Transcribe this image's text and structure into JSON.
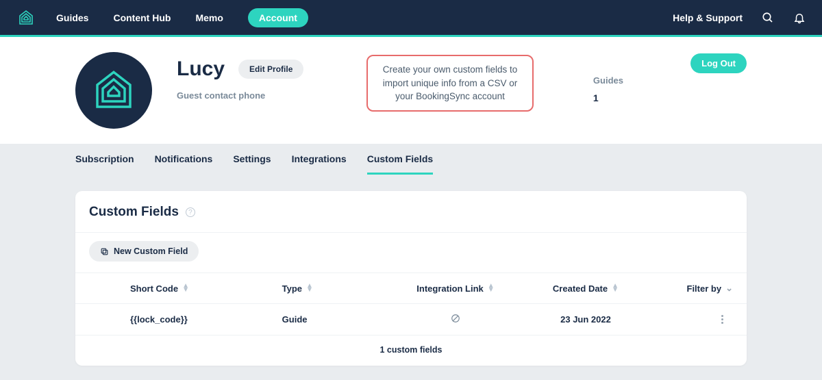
{
  "colors": {
    "accent": "#2dd4bf",
    "navy": "#1a2b45",
    "callout_border": "#e76b6b"
  },
  "nav": {
    "items": [
      "Guides",
      "Content Hub",
      "Memo",
      "Account"
    ],
    "active_index": 3,
    "help": "Help & Support"
  },
  "profile": {
    "name": "Lucy",
    "edit_label": "Edit Profile",
    "subtitle": "Guest contact phone",
    "callout": "Create your own custom fields to import unique info from a CSV or your BookingSync account",
    "stat_label": "Guides",
    "stat_value": "1",
    "logout": "Log Out"
  },
  "tabs": {
    "items": [
      "Subscription",
      "Notifications",
      "Settings",
      "Integrations",
      "Custom Fields"
    ],
    "active_index": 4
  },
  "card": {
    "title": "Custom Fields",
    "new_btn": "New Custom Field",
    "headers": {
      "short_code": "Short Code",
      "type": "Type",
      "integration_link": "Integration Link",
      "created_date": "Created Date",
      "filter_by": "Filter by"
    },
    "rows": [
      {
        "short_code": "{{lock_code}}",
        "type": "Guide",
        "integration_link": "blocked",
        "created_date": "23 Jun 2022"
      }
    ],
    "footer": "1 custom fields"
  }
}
